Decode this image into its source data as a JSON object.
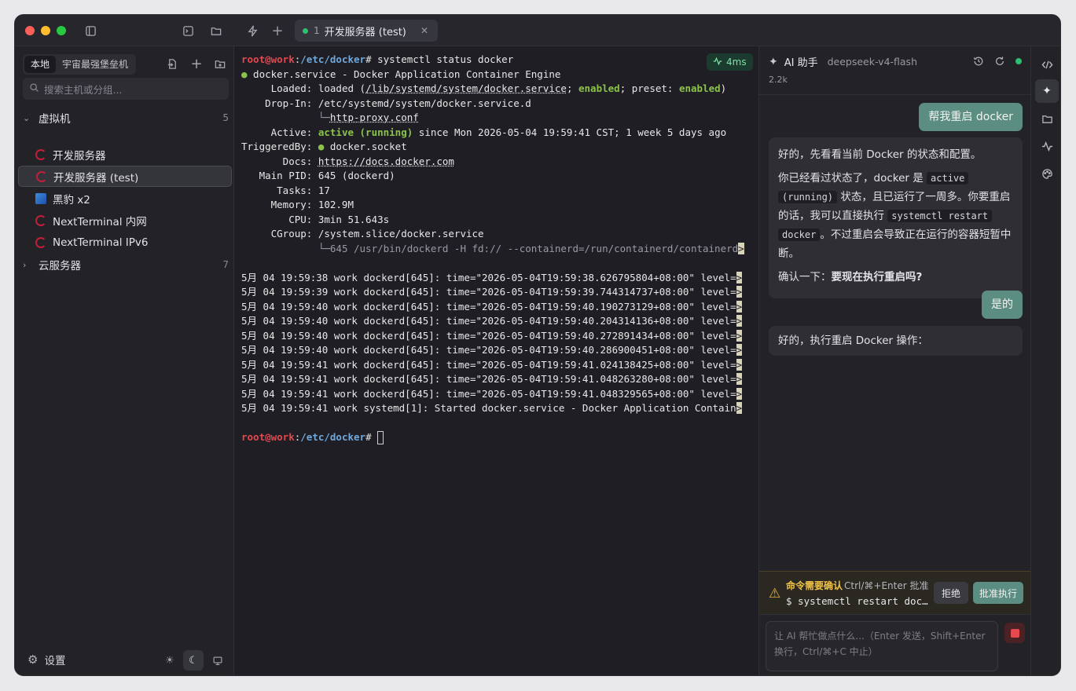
{
  "titlebar": {
    "tab_number": "1",
    "tab_title": "开发服务器 (test)"
  },
  "sidebar": {
    "segments": [
      "本地",
      "宇宙最强堡垒机"
    ],
    "search_placeholder": "搜索主机或分组...",
    "group_vm": {
      "label": "虚拟机",
      "count": "5"
    },
    "hosts": [
      {
        "label": "开发服务器",
        "icon": "debian-icon"
      },
      {
        "label": "开发服务器 (test)",
        "icon": "debian-icon"
      },
      {
        "label": "黑豹 x2",
        "icon": "cube-icon"
      },
      {
        "label": "NextTerminal 内网",
        "icon": "debian-icon"
      },
      {
        "label": "NextTerminal IPv6",
        "icon": "debian-icon"
      }
    ],
    "group_cloud": {
      "label": "云服务器",
      "count": "7"
    },
    "settings_label": "设置"
  },
  "terminal": {
    "latency": "4ms",
    "prompt_user": "root@work",
    "prompt_path": "/etc/docker",
    "prompt_tail": "# ",
    "cmd": "systemctl status docker",
    "unit_dot": "●",
    "unit_line": " docker.service - Docker Application Container Engine",
    "loaded_label": "     Loaded: ",
    "loaded_pre": "loaded (",
    "loaded_path": "/lib/systemd/system/docker.service",
    "loaded_mid1": "; ",
    "loaded_enabled": "enabled",
    "loaded_mid2": "; preset: ",
    "loaded_preset": "enabled",
    "loaded_end": ")",
    "dropin_label": "    Drop-In: ",
    "dropin_value": "/etc/systemd/system/docker.service.d",
    "dropin_tree_pad": "             ",
    "dropin_tree": "└─",
    "dropin_file": "http-proxy.conf",
    "active_label": "     Active: ",
    "active_value": "active (running)",
    "active_rest": " since Mon 2026-05-04 19:59:41 CST; 1 week 5 days ago",
    "trig_label": "TriggeredBy: ",
    "trig_dot": "●",
    "trig_value": " docker.socket",
    "docs_label": "       Docs: ",
    "docs_value": "https://docs.docker.com",
    "pid_line": "   Main PID: 645 (dockerd)",
    "tasks_line": "      Tasks: 17",
    "mem_line": "     Memory: 102.9M",
    "cpu_line": "        CPU: 3min 51.643s",
    "cgroup_line": "     CGroup: /system.slice/docker.service",
    "cgroup_tree_pad": "             ",
    "cgroup_tree": "└─645 /usr/bin/dockerd -H fd:// --containerd=/run/containerd/containerd",
    "log_lines": [
      "5月 04 19:59:38 work dockerd[645]: time=\"2026-05-04T19:59:38.626795804+08:00\" level=",
      "5月 04 19:59:39 work dockerd[645]: time=\"2026-05-04T19:59:39.744314737+08:00\" level=",
      "5月 04 19:59:40 work dockerd[645]: time=\"2026-05-04T19:59:40.190273129+08:00\" level=",
      "5月 04 19:59:40 work dockerd[645]: time=\"2026-05-04T19:59:40.204314136+08:00\" level=",
      "5月 04 19:59:40 work dockerd[645]: time=\"2026-05-04T19:59:40.272891434+08:00\" level=",
      "5月 04 19:59:40 work dockerd[645]: time=\"2026-05-04T19:59:40.286900451+08:00\" level=",
      "5月 04 19:59:41 work dockerd[645]: time=\"2026-05-04T19:59:41.024138425+08:00\" level=",
      "5月 04 19:59:41 work dockerd[645]: time=\"2026-05-04T19:59:41.048263280+08:00\" level=",
      "5月 04 19:59:41 work dockerd[645]: time=\"2026-05-04T19:59:41.048329565+08:00\" level=",
      "5月 04 19:59:41 work systemd[1]: Started docker.service - Docker Application Contain"
    ],
    "trunc_marker": ">"
  },
  "ai": {
    "title": "AI 助手",
    "model": "deepseek-v4-flash",
    "tokens": "2.2k",
    "messages": {
      "user1": "帮我重启 docker",
      "ai1_p1": "好的，先看看当前 Docker 的状态和配置。",
      "ai1_p2_a": "你已经看过状态了，docker 是 ",
      "ai1_p2_code1": "active",
      "ai1_p2_b": " ",
      "ai1_p2_code2": "(running)",
      "ai1_p2_c": " 状态，且已运行了一周多。你要重启的话，我可以直接执行 ",
      "ai1_p2_code3": "systemctl restart",
      "ai1_p2_d": " ",
      "ai1_p2_code4": "docker",
      "ai1_p2_e": "。不过重启会导致正在运行的容器短暂中断。",
      "ai1_p3_a": "确认一下：",
      "ai1_p3_b": "要现在执行重启吗?",
      "user2": "是的",
      "ai2": "好的，执行重启 Docker 操作："
    },
    "confirm": {
      "title": "命令需要确认",
      "hint": "Ctrl/⌘+Enter 批准",
      "cmd": "$ systemctl restart docker",
      "reject": "拒绝",
      "approve": "批准执行"
    },
    "input_placeholder": "让 AI 帮忙做点什么...（Enter 发送，Shift+Enter 换行，Ctrl/⌘+C 中止）"
  }
}
